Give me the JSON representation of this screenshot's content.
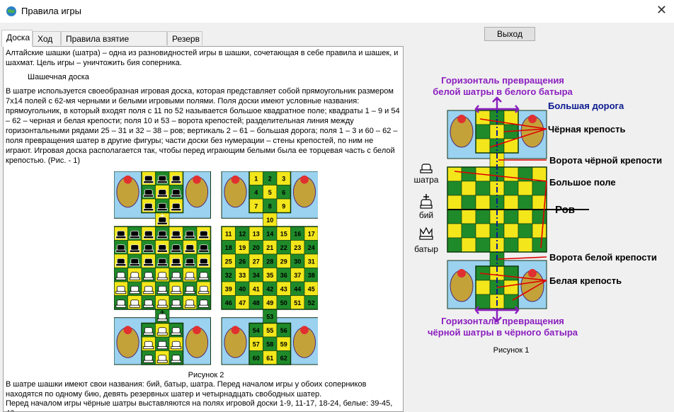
{
  "window": {
    "title": "Правила игры"
  },
  "tabs": [
    {
      "label": "Доска",
      "active": true
    },
    {
      "label": "Ход",
      "active": false
    },
    {
      "label": "Правила взятие фигурами",
      "active": false
    },
    {
      "label": "Резерв",
      "active": false
    }
  ],
  "exit_label": "Выход",
  "text": {
    "p1": "Алтайские шашки (шатра) – одна из разновидностей игры в шашки, сочетающая в себе правила и шашек, и шахмат. Цель игры – уничтожить бия соперника.",
    "subheading": "Шашечная доска",
    "p2": "В шатре используется своеобразная игровая доска, которая представляет собой прямоугольник размером 7х14 полей с 62-мя черными и белыми игровыми полями. Поля доски имеют условные названия: прямоугольник, в который входят поля с 11 по 52 называется большое квадратное поле; квадраты 1 – 9 и 54 – 62 – черная и белая крепости; поля 10 и 53 – ворота крепостей; разделительная линия между горизонтальными рядами 25 – 31 и 32 – 38 – ров; вертикаль 2 – 61 – большая дорога; поля 1 – 3 и 60 – 62 – поля превращения шатер в другие фигуры; части доски без нумерации – стены крепостей, по ним не играют. Игровая доска располагается так, чтобы перед играющим белыми была ее торцевая часть с белой крепостью. (Рис. - 1)",
    "fig2_caption": "Рисунок 2",
    "p3": "В шатре шашки имеют свои названия: бий, батыр, шатра. Перед началом игры у обоих соперников находятся по одному бию, девять резервных шатер и четырнадцать свободных шатер.",
    "p4": "Перед началом игры чёрные шатры выставляются на полях игровой доски 1-9, 11-17, 18-24, белые: 39-45, 46-"
  },
  "board_numbers": {
    "top": [
      [
        "1",
        "2",
        "3"
      ],
      [
        "4",
        "5",
        "6"
      ],
      [
        "7",
        "8",
        "9"
      ]
    ],
    "gate_top": "10",
    "middle": [
      [
        "11",
        "12",
        "13",
        "14",
        "15",
        "16",
        "17"
      ],
      [
        "18",
        "19",
        "20",
        "21",
        "22",
        "23",
        "24"
      ],
      [
        "25",
        "26",
        "27",
        "28",
        "29",
        "30",
        "31"
      ],
      [
        "32",
        "33",
        "34",
        "35",
        "36",
        "37",
        "38"
      ],
      [
        "39",
        "40",
        "41",
        "42",
        "43",
        "44",
        "45"
      ],
      [
        "46",
        "47",
        "48",
        "49",
        "50",
        "51",
        "52"
      ]
    ],
    "gate_bottom": "53",
    "bottom": [
      [
        "54",
        "55",
        "56"
      ],
      [
        "57",
        "58",
        "59"
      ],
      [
        "60",
        "61",
        "62"
      ]
    ]
  },
  "fig1": {
    "top_purple_1": "Горизонталь превращения",
    "top_purple_2": "белой шатры в белого батыра",
    "big_road": "Большая  дорога",
    "black_fortress": "Чёрная крепость",
    "black_gate": "Ворота чёрной крепости",
    "big_field": "Большое поле",
    "moat": "Ров",
    "white_gate": "Ворота белой крепости",
    "white_fortress": "Белая крепость",
    "bottom_purple_1": "Горизонталь превращения",
    "bottom_purple_2": "чёрной шатры в чёрного батыра",
    "caption": "Рисунок 1",
    "piece_shatra": "шатра",
    "piece_biy": "бий",
    "piece_batyr": "батыр"
  },
  "colors": {
    "yellow": "#f3e61b",
    "green": "#1f8a2a",
    "sky": "#9ad2f0",
    "dark": "#163516",
    "purple": "#8b1fbf",
    "navy": "#0b1a8f",
    "red": "#e00000"
  }
}
